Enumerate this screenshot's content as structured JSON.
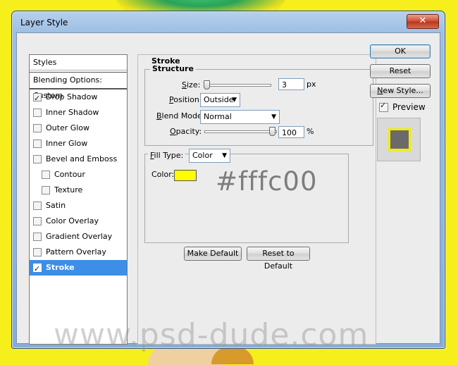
{
  "window": {
    "title": "Layer Style",
    "close_label": "✕"
  },
  "styles_list": {
    "header": "Styles",
    "blending": "Blending Options: Custom",
    "items": [
      {
        "label": "Drop Shadow",
        "checked": true
      },
      {
        "label": "Inner Shadow",
        "checked": false
      },
      {
        "label": "Outer Glow",
        "checked": false
      },
      {
        "label": "Inner Glow",
        "checked": false
      },
      {
        "label": "Bevel and Emboss",
        "checked": false
      },
      {
        "label": "Contour",
        "checked": false
      },
      {
        "label": "Texture",
        "checked": false
      },
      {
        "label": "Satin",
        "checked": false
      },
      {
        "label": "Color Overlay",
        "checked": false
      },
      {
        "label": "Gradient Overlay",
        "checked": false
      },
      {
        "label": "Pattern Overlay",
        "checked": false
      },
      {
        "label": "Stroke",
        "checked": true
      }
    ]
  },
  "stroke": {
    "title": "Stroke",
    "structure_title": "Structure",
    "size_label_u": "S",
    "size_label_rest": "ize:",
    "size_value": "3",
    "size_unit": "px",
    "size_level": 0.03,
    "position_label_u": "P",
    "position_label_rest": "osition:",
    "position_value": "Outside",
    "blend_label_u": "B",
    "blend_label_rest": "lend Mode:",
    "blend_value": "Normal",
    "opacity_label_u": "O",
    "opacity_label_rest": "pacity:",
    "opacity_value": "100",
    "opacity_unit": "%",
    "opacity_level": 1.0,
    "fill_label_u": "F",
    "fill_label_rest": "ill Type:",
    "fill_value": "Color",
    "color_label": "Color:",
    "color_hex": "#fffc00",
    "overlay_text": "#fffc00",
    "make_default": "Make Default",
    "reset_default": "Reset to Default"
  },
  "buttons": {
    "ok": "OK",
    "reset": "Reset",
    "new_style_u": "N",
    "new_style_rest": "ew Style...",
    "preview_label": "Preview",
    "preview_checked": true
  },
  "watermark": "www.psd-dude.com"
}
